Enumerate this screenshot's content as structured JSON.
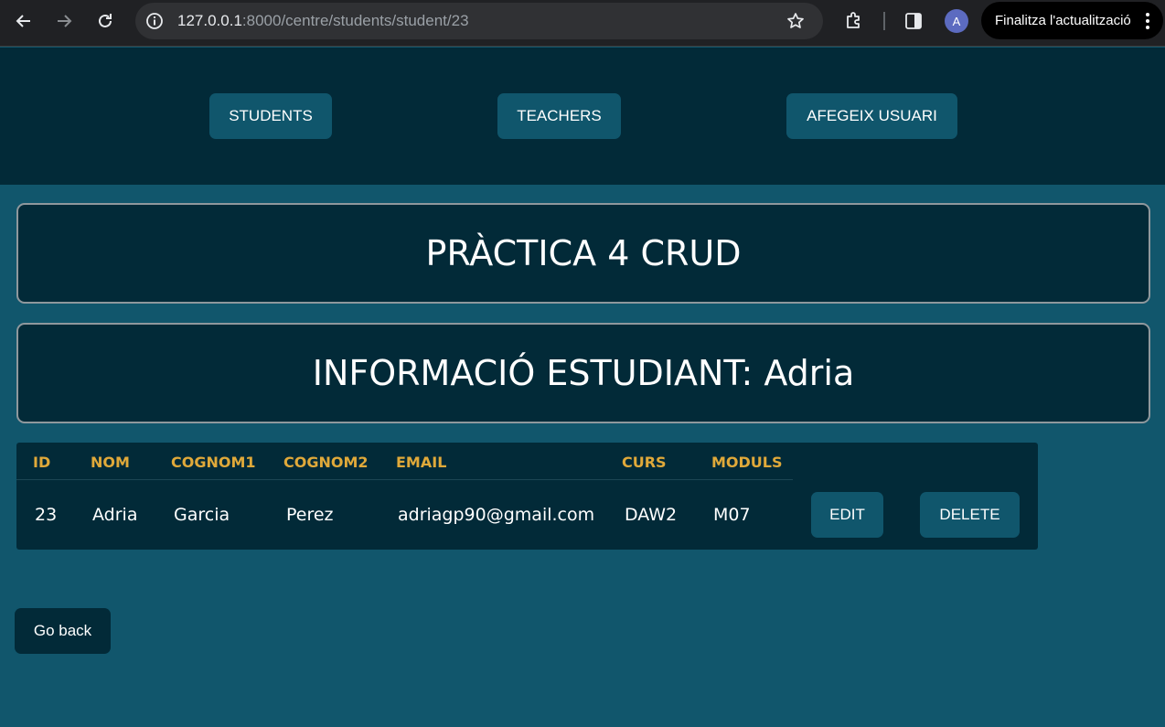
{
  "browser": {
    "url_host": "127.0.0.1",
    "url_path": ":8000/centre/students/student/23",
    "profile_initial": "A",
    "update_button": "Finalitza l'actualització",
    "icons": [
      "back-arrow-icon",
      "forward-arrow-icon",
      "reload-icon",
      "site-info-icon",
      "bookmark-star-icon",
      "extensions-icon",
      "side-panel-icon",
      "more-menu-icon"
    ]
  },
  "nav": {
    "students": "STUDENTS",
    "teachers": "TEACHERS",
    "add_user": "AFEGEIX USUARI"
  },
  "page_title": "PRÀCTICA 4 CRUD",
  "section_title": "INFORMACIÓ ESTUDIANT: Adria",
  "table": {
    "headers": [
      "ID",
      "NOM",
      "COGNOM1",
      "COGNOM2",
      "EMAIL",
      "CURS",
      "MODULS"
    ],
    "row": [
      "23",
      "Adria",
      "Garcia",
      "Perez",
      "adriagp90@gmail.com",
      "DAW2",
      "M07"
    ],
    "edit_label": "EDIT",
    "delete_label": "DELETE"
  },
  "back_label": "Go back",
  "colors": {
    "page_bg": "#11566c",
    "dark_panel": "#022a38",
    "button_bg": "#10566c",
    "header_text": "#e0a93a"
  }
}
